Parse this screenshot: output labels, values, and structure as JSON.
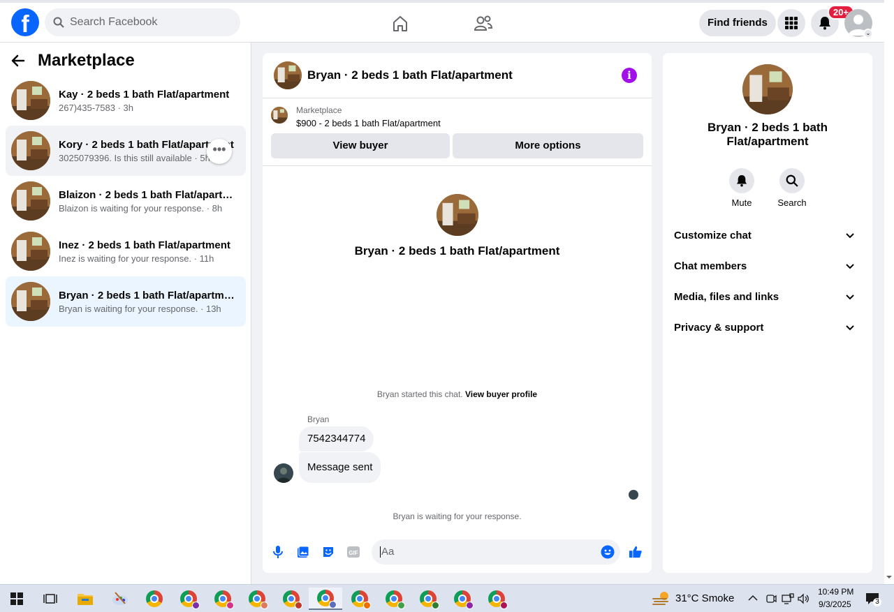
{
  "header": {
    "search_placeholder": "Search Facebook",
    "find_friends": "Find friends",
    "notification_badge": "20+"
  },
  "sidebar": {
    "title": "Marketplace",
    "conversations": [
      {
        "title": "Kay · 2 beds 1 bath Flat/apartment",
        "subtitle": "267)435-7583 · 3h"
      },
      {
        "title": "Kory · 2 beds 1 bath Flat/apartment",
        "subtitle": "3025079396. Is this still available · 5h"
      },
      {
        "title": "Blaizon · 2 beds 1 bath Flat/apartm...",
        "subtitle": "Blaizon is waiting for your response. · 8h"
      },
      {
        "title": "Inez · 2 beds 1 bath Flat/apartment",
        "subtitle": "Inez is waiting for your response. · 11h"
      },
      {
        "title": "Bryan · 2 beds 1 bath Flat/apartment",
        "subtitle": "Bryan is waiting for your response. · 13h"
      }
    ]
  },
  "chat": {
    "title": "Bryan · 2 beds 1 bath Flat/apartment",
    "listing_label": "Marketplace",
    "listing_price": "$900 - 2 beds 1 bath Flat/apartment",
    "view_buyer": "View buyer",
    "more_options": "More options",
    "profile_name": "Bryan · 2 beds 1 bath Flat/apartment",
    "started_text": "Bryan started this chat. ",
    "view_buyer_profile": "View buyer profile",
    "sender": "Bryan",
    "messages": [
      "7542344774",
      "Message sent"
    ],
    "waiting": "Bryan is waiting for your response.",
    "composer_placeholder": "Aa"
  },
  "right_panel": {
    "name": "Bryan · 2 beds 1 bath Flat/apartment",
    "mute": "Mute",
    "search": "Search",
    "sections": [
      "Customize chat",
      "Chat members",
      "Media, files and links",
      "Privacy & support"
    ]
  },
  "taskbar": {
    "weather": "31°C  Smoke",
    "time": "10:49 PM",
    "date": "9/3/2025",
    "notifications": "3"
  }
}
